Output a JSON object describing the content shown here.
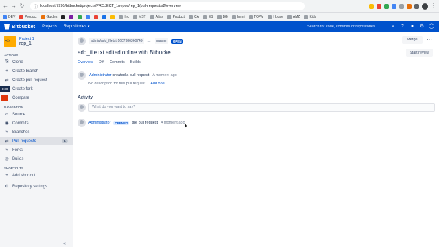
{
  "browser": {
    "url": "localhost:7990/bitbucket/projects/PROJECT_1/repos/rep_1/pull-requests/2/overview",
    "bookmarks": [
      "DEV",
      "Product",
      "Guides",
      "Inc",
      "MST",
      "Atlas",
      "Product",
      "CA",
      "ES",
      "BG",
      "Immi",
      "ГОРМ",
      "House",
      "AMZ",
      "Kids"
    ]
  },
  "header": {
    "logo": "Bitbucket",
    "projects": "Projects",
    "repositories": "Repositories",
    "search_placeholder": "Search for code, commits or repositories..."
  },
  "sidebar": {
    "project": "Project 1",
    "repo": "rep_1",
    "actions_title": "ACTIONS",
    "actions": [
      "Clone",
      "Create branch",
      "Create pull request",
      "Create fork",
      "Compare"
    ],
    "timer": "1:30",
    "navigation_title": "NAVIGATION",
    "nav": [
      "Source",
      "Commits",
      "Branches",
      "Pull requests",
      "Forks",
      "Builds"
    ],
    "pr_count": "1",
    "shortcuts_title": "SHORTCUTS",
    "add_shortcut": "Add shortcut",
    "settings": "Repository settings"
  },
  "pr": {
    "source_branch": "admin/add_filetxt-1607386360749",
    "target_branch": "master",
    "state": "OPEN",
    "merge": "Merge",
    "title": "add_file.txt edited online with Bitbucket",
    "start_review": "Start review",
    "tabs": [
      "Overview",
      "Diff",
      "Commits",
      "Builds"
    ],
    "author": "Administrator",
    "created_text": "created a pull request",
    "created_time": "A moment ago",
    "no_desc": "No description for this pull request.",
    "add_one": "Add one",
    "activity": "Activity",
    "comment_placeholder": "What do you want to say?",
    "opened_badge": "OPENED",
    "opened_text": "the pull request",
    "opened_time": "A moment ago"
  },
  "colors": {
    "brand": "#0052cc",
    "project_logo": "#ffab00"
  }
}
